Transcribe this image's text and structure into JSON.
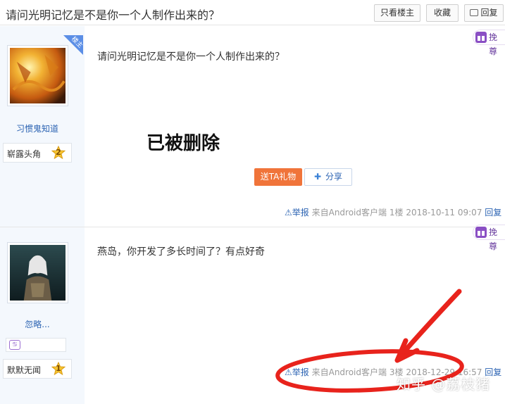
{
  "thread": {
    "title": "请问光明记忆是不是你一个人制作出来的？",
    "buttons": {
      "only_op": "只看楼主",
      "favorite": "收藏",
      "reply": "回复"
    }
  },
  "posts": [
    {
      "username": "习惯鬼知道",
      "op_badge": "楼主",
      "level_name": "崭露头角",
      "level_num": "2",
      "text": "请问光明记忆是不是你一个人制作出来的？",
      "stamp": "已被删除",
      "gift_button": "送TA礼物",
      "share_button": "分享",
      "appreciate": "挽尊",
      "tail": {
        "report": "举报",
        "source": "来自Android客户端",
        "floor": "1楼",
        "time": "2018-10-11 09:07",
        "reply": "回复"
      }
    },
    {
      "username": "忽略...",
      "zodiac": "♋",
      "level_name": "默默无闻",
      "level_num": "1",
      "text": "燕岛，你开发了多长时间了？有点好奇",
      "appreciate": "挽尊",
      "tail": {
        "report": "举报",
        "source": "来自Android客户端",
        "floor": "3楼",
        "time": "2018-12-29 16:57",
        "reply": "回复"
      }
    }
  ],
  "watermark": "知乎 @荔枝猪",
  "colors": {
    "link": "#2d64b3",
    "gift": "#f0743a",
    "annotation": "#e8231c",
    "sidebar": "#f4f8fd"
  }
}
